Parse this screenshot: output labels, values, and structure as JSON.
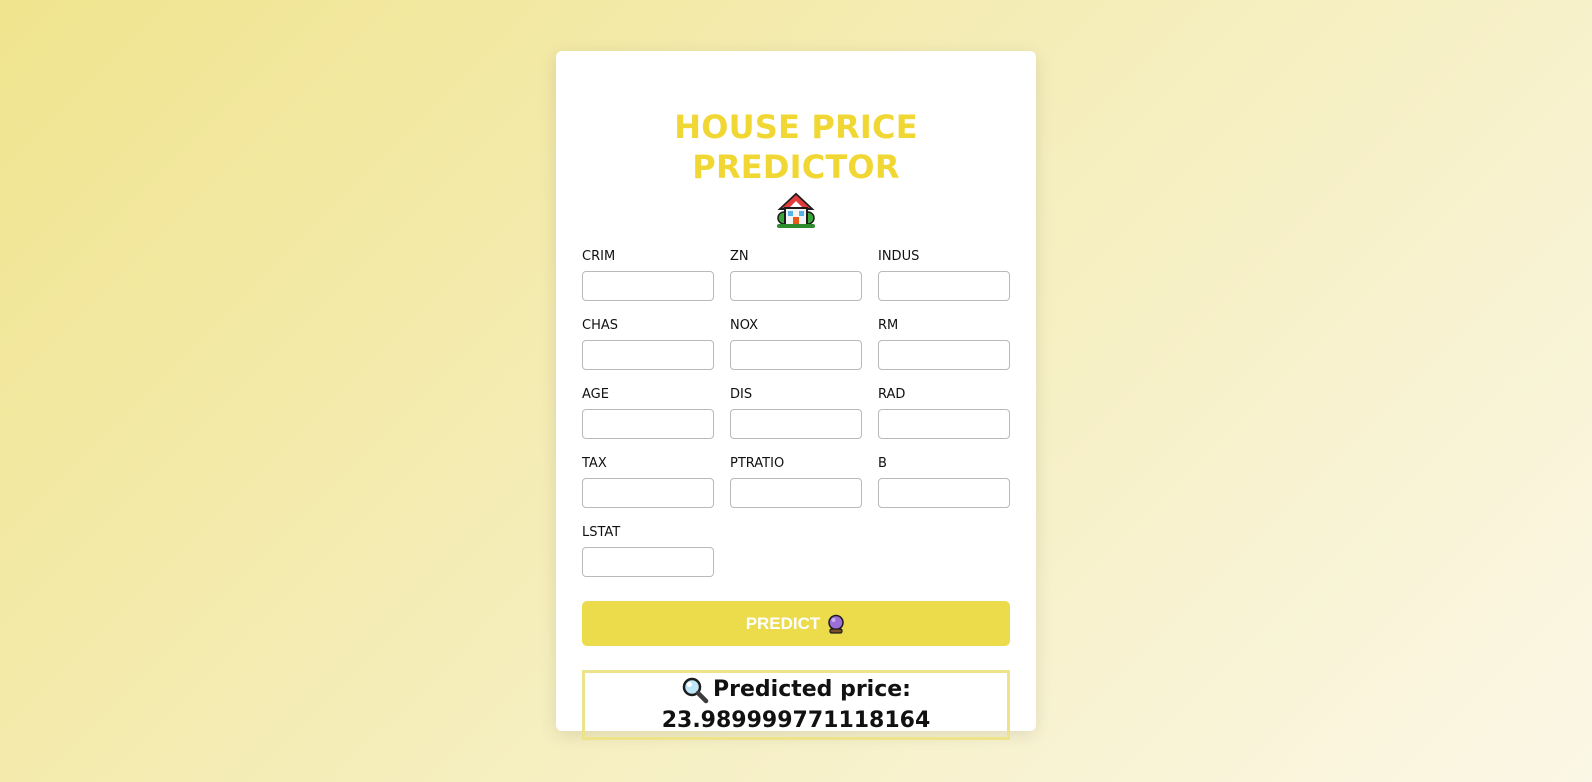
{
  "app": {
    "title": "HOUSE PRICE PREDICTOR",
    "title_color": "#f0d733"
  },
  "form": {
    "fields": [
      {
        "label": "CRIM",
        "value": ""
      },
      {
        "label": "ZN",
        "value": ""
      },
      {
        "label": "INDUS",
        "value": ""
      },
      {
        "label": "CHAS",
        "value": ""
      },
      {
        "label": "NOX",
        "value": ""
      },
      {
        "label": "RM",
        "value": ""
      },
      {
        "label": "AGE",
        "value": ""
      },
      {
        "label": "DIS",
        "value": ""
      },
      {
        "label": "RAD",
        "value": ""
      },
      {
        "label": "TAX",
        "value": ""
      },
      {
        "label": "PTRATIO",
        "value": ""
      },
      {
        "label": "B",
        "value": ""
      },
      {
        "label": "LSTAT",
        "value": ""
      }
    ],
    "predict_label": "PREDICT",
    "predict_icon": "crystal-ball-icon",
    "button_color": "#ecdc4b"
  },
  "result": {
    "label": "Predicted price:",
    "value": "23.989999771118164",
    "icon": "magnifier-icon",
    "border_color": "#ece38a"
  },
  "icons": {
    "house": "house-with-garden-icon"
  }
}
